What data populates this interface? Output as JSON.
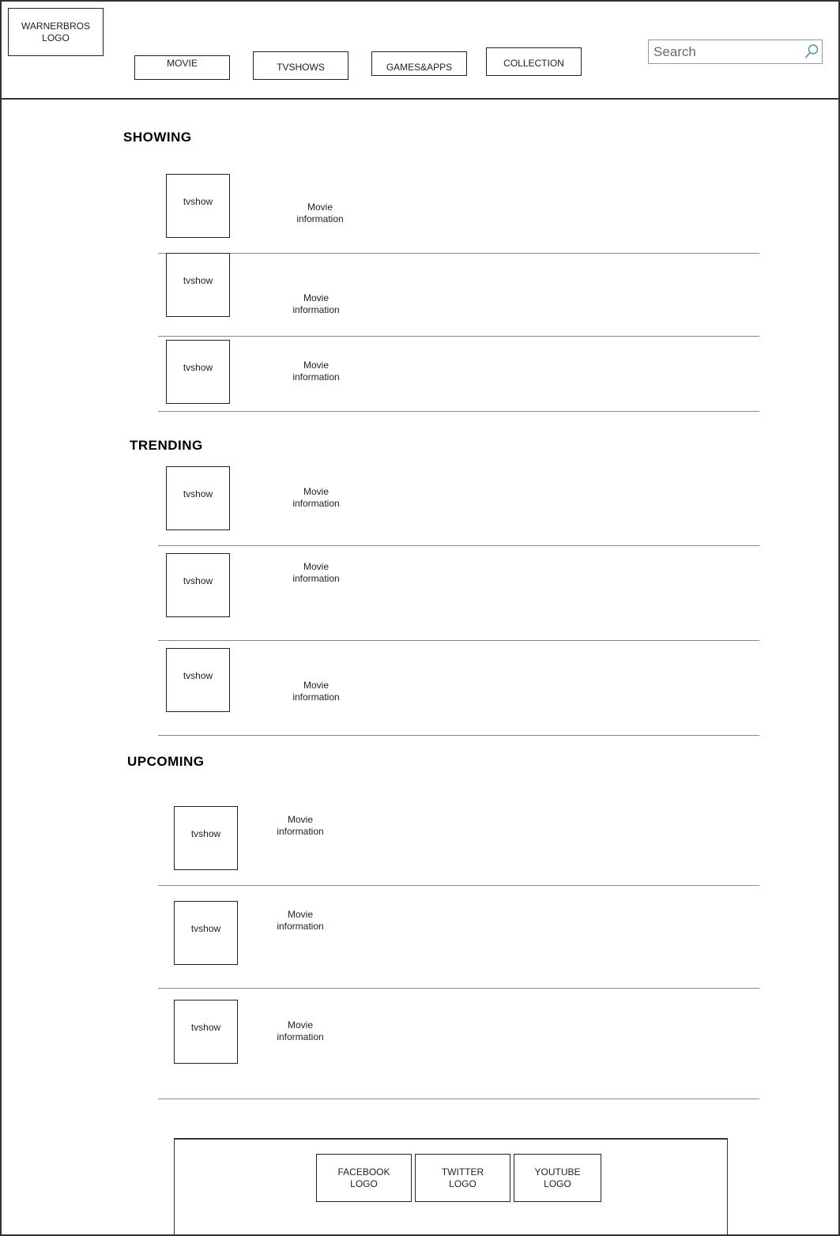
{
  "header": {
    "logo": [
      "WARNERBROS",
      "LOGO"
    ],
    "nav": [
      "MOVIE",
      "TVSHOWS",
      "GAMES&APPS",
      "COLLECTION"
    ],
    "search_placeholder": "Search"
  },
  "sections": [
    {
      "title": "SHOWING",
      "items": [
        {
          "thumb": "tvshow",
          "info": [
            "Movie",
            "information"
          ]
        },
        {
          "thumb": "tvshow",
          "info": [
            "Movie",
            "information"
          ]
        },
        {
          "thumb": "tvshow",
          "info": [
            "Movie",
            "information"
          ]
        }
      ]
    },
    {
      "title": "TRENDING",
      "items": [
        {
          "thumb": "tvshow",
          "info": [
            "Movie",
            "information"
          ]
        },
        {
          "thumb": "tvshow",
          "info": [
            "Movie",
            "information"
          ]
        },
        {
          "thumb": "tvshow",
          "info": [
            "Movie",
            "information"
          ]
        }
      ]
    },
    {
      "title": "UPCOMING",
      "items": [
        {
          "thumb": "tvshow",
          "info": [
            "Movie",
            "information"
          ]
        },
        {
          "thumb": "tvshow",
          "info": [
            "Movie",
            "information"
          ]
        },
        {
          "thumb": "tvshow",
          "info": [
            "Movie",
            "information"
          ]
        }
      ]
    }
  ],
  "footer": {
    "social": [
      [
        "FACEBOOK",
        "LOGO"
      ],
      [
        "TWITTER",
        "LOGO"
      ],
      [
        "YOUTUBE",
        "LOGO"
      ]
    ]
  }
}
